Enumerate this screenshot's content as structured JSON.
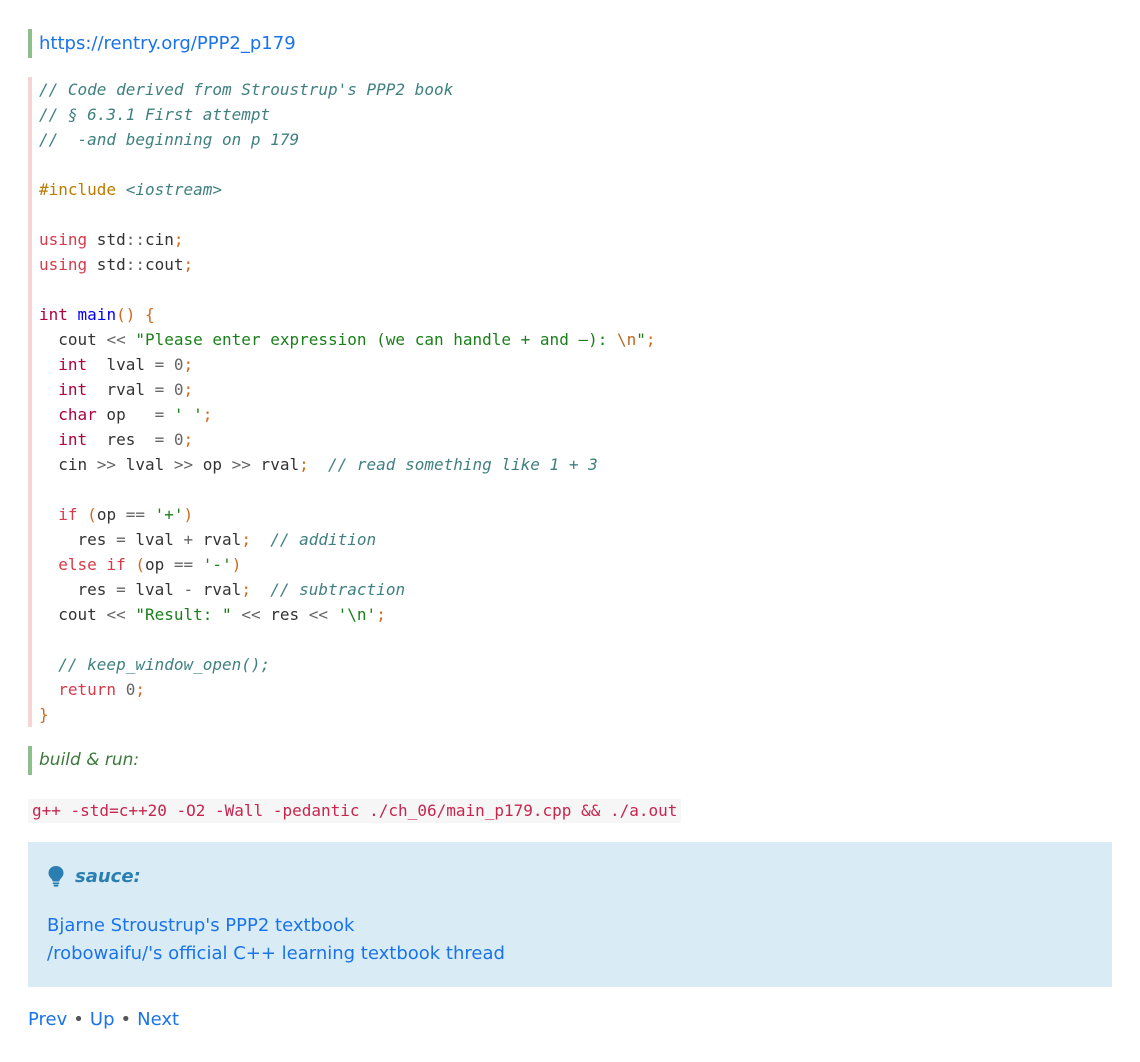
{
  "source_link": "https://rentry.org/PPP2_p179",
  "build_label": "build & run:",
  "build_command": "g++ -std=c++20 -O2 -Wall -pedantic ./ch_06/main_p179.cpp && ./a.out",
  "code_lines": [
    [
      [
        "// Code derived from Stroustrup's PPP2 book",
        "comment"
      ]
    ],
    [
      [
        "// § 6.3.1 First attempt",
        "comment"
      ]
    ],
    [
      [
        "//  -and beginning on p 179",
        "comment"
      ]
    ],
    [],
    [
      [
        "#include",
        "pre"
      ],
      [
        " ",
        ""
      ],
      [
        "<iostream>",
        "incl"
      ]
    ],
    [],
    [
      [
        "using",
        "kw"
      ],
      [
        " std",
        ""
      ],
      [
        "::",
        "op"
      ],
      [
        "cin",
        ""
      ],
      [
        ";",
        "punct"
      ]
    ],
    [
      [
        "using",
        "kw"
      ],
      [
        " std",
        ""
      ],
      [
        "::",
        "op"
      ],
      [
        "cout",
        ""
      ],
      [
        ";",
        "punct"
      ]
    ],
    [],
    [
      [
        "int",
        "type"
      ],
      [
        " ",
        ""
      ],
      [
        "main",
        "fn"
      ],
      [
        "()",
        "punct"
      ],
      [
        " ",
        ""
      ],
      [
        "{",
        "punct"
      ]
    ],
    [
      [
        "  cout ",
        ""
      ],
      [
        "<<",
        "op"
      ],
      [
        " ",
        ""
      ],
      [
        "\"Please enter expression (we can handle + and –): ",
        "str"
      ],
      [
        "\\n",
        "esc"
      ],
      [
        "\"",
        "str"
      ],
      [
        ";",
        "punct"
      ]
    ],
    [
      [
        "  ",
        ""
      ],
      [
        "int",
        "type"
      ],
      [
        "  lval ",
        ""
      ],
      [
        "=",
        "op"
      ],
      [
        " ",
        ""
      ],
      [
        "0",
        "num"
      ],
      [
        ";",
        "punct"
      ]
    ],
    [
      [
        "  ",
        ""
      ],
      [
        "int",
        "type"
      ],
      [
        "  rval ",
        ""
      ],
      [
        "=",
        "op"
      ],
      [
        " ",
        ""
      ],
      [
        "0",
        "num"
      ],
      [
        ";",
        "punct"
      ]
    ],
    [
      [
        "  ",
        ""
      ],
      [
        "char",
        "type"
      ],
      [
        " op   ",
        ""
      ],
      [
        "=",
        "op"
      ],
      [
        " ",
        ""
      ],
      [
        "' '",
        "str"
      ],
      [
        ";",
        "punct"
      ]
    ],
    [
      [
        "  ",
        ""
      ],
      [
        "int",
        "type"
      ],
      [
        "  res  ",
        ""
      ],
      [
        "=",
        "op"
      ],
      [
        " ",
        ""
      ],
      [
        "0",
        "num"
      ],
      [
        ";",
        "punct"
      ]
    ],
    [
      [
        "  cin ",
        ""
      ],
      [
        ">>",
        "op"
      ],
      [
        " lval ",
        ""
      ],
      [
        ">>",
        "op"
      ],
      [
        " op ",
        ""
      ],
      [
        ">>",
        "op"
      ],
      [
        " rval",
        ""
      ],
      [
        ";",
        "punct"
      ],
      [
        "  ",
        ""
      ],
      [
        "// read something like 1 + 3",
        "comment"
      ]
    ],
    [],
    [
      [
        "  ",
        ""
      ],
      [
        "if",
        "kw"
      ],
      [
        " ",
        ""
      ],
      [
        "(",
        "punct"
      ],
      [
        "op ",
        ""
      ],
      [
        "==",
        "op"
      ],
      [
        " ",
        ""
      ],
      [
        "'+'",
        "str"
      ],
      [
        ")",
        "punct"
      ]
    ],
    [
      [
        "    res ",
        ""
      ],
      [
        "=",
        "op"
      ],
      [
        " lval ",
        ""
      ],
      [
        "+",
        "op"
      ],
      [
        " rval",
        ""
      ],
      [
        ";",
        "punct"
      ],
      [
        "  ",
        ""
      ],
      [
        "// addition",
        "comment"
      ]
    ],
    [
      [
        "  ",
        ""
      ],
      [
        "else",
        "kw"
      ],
      [
        " ",
        ""
      ],
      [
        "if",
        "kw"
      ],
      [
        " ",
        ""
      ],
      [
        "(",
        "punct"
      ],
      [
        "op ",
        ""
      ],
      [
        "==",
        "op"
      ],
      [
        " ",
        ""
      ],
      [
        "'-'",
        "str"
      ],
      [
        ")",
        "punct"
      ]
    ],
    [
      [
        "    res ",
        ""
      ],
      [
        "=",
        "op"
      ],
      [
        " lval ",
        ""
      ],
      [
        "-",
        "op"
      ],
      [
        " rval",
        ""
      ],
      [
        ";",
        "punct"
      ],
      [
        "  ",
        ""
      ],
      [
        "// subtraction",
        "comment"
      ]
    ],
    [
      [
        "  cout ",
        ""
      ],
      [
        "<<",
        "op"
      ],
      [
        " ",
        ""
      ],
      [
        "\"Result: \"",
        "str"
      ],
      [
        " ",
        ""
      ],
      [
        "<<",
        "op"
      ],
      [
        " res ",
        ""
      ],
      [
        "<<",
        "op"
      ],
      [
        " ",
        ""
      ],
      [
        "'\\n'",
        "str"
      ],
      [
        ";",
        "punct"
      ]
    ],
    [],
    [
      [
        "  ",
        ""
      ],
      [
        "// keep_window_open();",
        "comment"
      ]
    ],
    [
      [
        "  ",
        ""
      ],
      [
        "return",
        "kw"
      ],
      [
        " ",
        ""
      ],
      [
        "0",
        "num"
      ],
      [
        ";",
        "punct"
      ]
    ],
    [
      [
        "}",
        "punct"
      ]
    ]
  ],
  "admonition": {
    "title": "sauce:",
    "icon": "lightbulb-icon",
    "links": [
      "Bjarne Stroustrup's PPP2 textbook",
      "/robowaifu/'s official C++ learning textbook thread"
    ]
  },
  "nav": {
    "prev": "Prev",
    "up": "Up",
    "next": "Next",
    "separator": "•"
  }
}
